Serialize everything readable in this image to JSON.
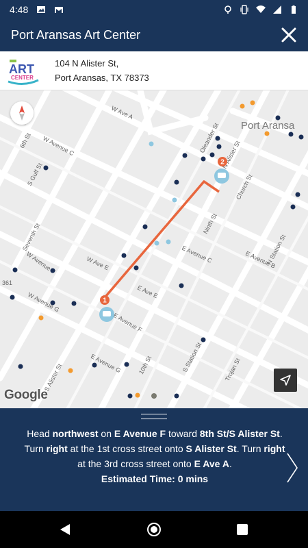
{
  "status_bar": {
    "time": "4:48"
  },
  "header": {
    "title": "Port Aransas Art Center"
  },
  "address": {
    "line1": "104 N Alister St,",
    "line2": "Port Aransas, TX 78373"
  },
  "map": {
    "labels": {
      "town": "Port Aransa",
      "streets": [
        "W Ave A",
        "W Avenue C",
        "S Gulf St",
        "6th St",
        "Oleander St",
        "N Alister St",
        "Church St",
        "Ninth St",
        "Seventh St",
        "W Avenue F",
        "W Ave E",
        "E Avenue C",
        "E Ave E",
        "E Avenue F",
        "W Avenue G",
        "E Avenue G",
        "10th St",
        "S Station St",
        "Trojan St",
        "S Alister St",
        "E Avenue B",
        "N Station St",
        "361"
      ]
    },
    "markers": [
      "1",
      "2"
    ],
    "attribution": "Google"
  },
  "directions": {
    "w1": "Head ",
    "b1": "northwest",
    "w2": " on ",
    "b2": "E Avenue F",
    "w3": " toward ",
    "b3": "8th St/S Alister St",
    "w4": ". Turn ",
    "b4": "right",
    "w5": " at the 1st cross street onto ",
    "b5": "S Alister St",
    "w6": ". Turn ",
    "b6": "right",
    "w7": " at the 3rd cross street onto ",
    "b7": "E Ave A",
    "w8": ".",
    "estimated": "Estimated Time: 0 mins"
  },
  "colors": {
    "primary": "#1a355a",
    "route": "#e8663d",
    "marker_light": "#8ec7e0",
    "marker_dark": "#1a2e55",
    "marker_orange": "#f39a2e"
  }
}
